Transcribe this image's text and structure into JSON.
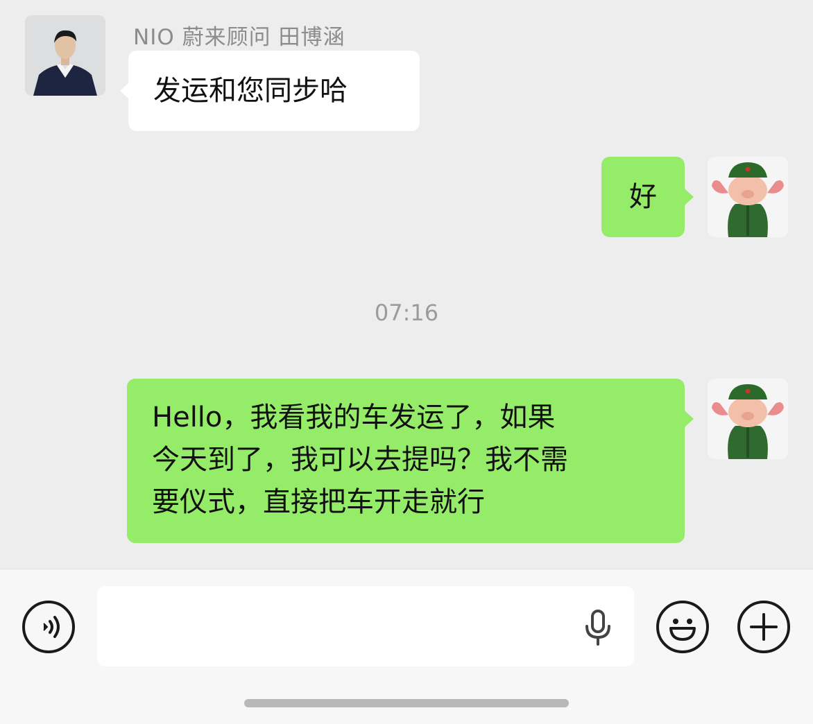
{
  "chat": {
    "sender_name": "NIO 蔚来顾问 田博涵",
    "messages": [
      {
        "direction": "in",
        "text": "发运和您同步哈"
      },
      {
        "direction": "out",
        "text": "好"
      },
      {
        "direction": "out",
        "lines": [
          "Hello，我看我的车发运了，如果",
          "今天到了，我可以去提吗？我不需",
          "要仪式，直接把车开走就行"
        ]
      }
    ],
    "timestamp": "07:16"
  },
  "input_bar": {
    "voice_icon": "voice-mode-icon",
    "mic_icon": "microphone-icon",
    "emoji_icon": "emoji-icon",
    "plus_icon": "plus-icon",
    "input_value": ""
  },
  "colors": {
    "background": "#ededed",
    "outgoing_bubble": "#95ec69",
    "incoming_bubble": "#ffffff"
  }
}
